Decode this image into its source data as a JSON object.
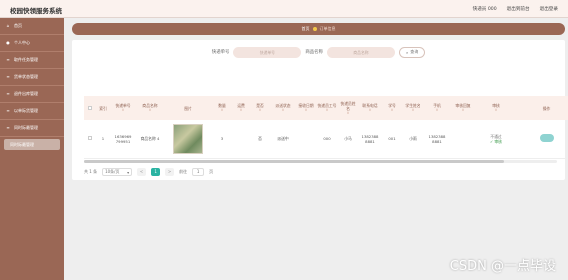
{
  "header": {
    "title": "校园快领服务系统",
    "user_label": "快递员 000",
    "back_home": "退出到前台",
    "logout": "退出登录"
  },
  "sidebar": {
    "items": [
      {
        "label": "首页",
        "icon": "home-icon"
      },
      {
        "label": "个人中心",
        "icon": "user-icon"
      },
      {
        "label": "取件任务管理",
        "icon": "list-icon"
      },
      {
        "label": "货单状态管理",
        "icon": "list-icon"
      },
      {
        "label": "退件出库管理",
        "icon": "list-icon"
      },
      {
        "label": "以单际货管理",
        "icon": "list-icon"
      },
      {
        "label": "同时际最管理",
        "icon": "list-icon"
      },
      {
        "label": "同时际最管理",
        "icon": "list-icon"
      }
    ]
  },
  "breadcrumb": {
    "home": "首页",
    "current": "订单信息"
  },
  "search": {
    "field1_label": "快递单号",
    "field1_placeholder": "快递单号",
    "field2_label": "商品名称",
    "field2_placeholder": "商品名称",
    "button": "查询"
  },
  "table": {
    "headers": [
      "索引",
      "快递单号",
      "商品名称",
      "图片",
      "数量",
      "运费",
      "是否",
      "派送状态",
      "接收日期",
      "快递员工号",
      "快递员姓名",
      "联系电话",
      "学号",
      "学生姓名",
      "手机",
      "审核回复",
      "审核",
      "操作"
    ],
    "rows": [
      {
        "index": "1",
        "tracking": "1636969 799951",
        "product": "商品名称 4",
        "qty": "3",
        "fee": "",
        "paid": "否",
        "status": "派送中",
        "date": "",
        "courier_id": "000",
        "courier_name": "小马",
        "phone": "1382388 8881",
        "student_id": "001",
        "student_name": "小雨",
        "mobile": "1382388 8881",
        "reply": "",
        "review_top": "不通过",
        "review_bottom": "✓ 审核"
      }
    ]
  },
  "pager": {
    "total": "共 1 条",
    "page_size": "10条/页",
    "prev": "<",
    "page": "1",
    "next": ">",
    "goto_label": "前往",
    "goto_value": "1",
    "goto_suffix": "页"
  },
  "watermark": "CSDN @一点毕设"
}
